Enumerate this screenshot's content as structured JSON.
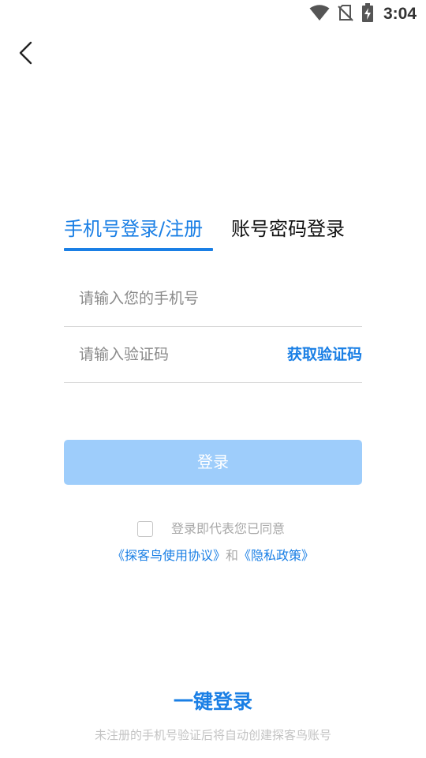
{
  "status_bar": {
    "time": "3:04",
    "icons": [
      "wifi-icon",
      "no-sim-icon",
      "battery-charging-icon"
    ]
  },
  "nav": {
    "back_icon": "chevron-left-icon"
  },
  "tabs": [
    {
      "label": "手机号登录/注册",
      "active": true
    },
    {
      "label": "账号密码登录",
      "active": false
    }
  ],
  "phone_field": {
    "placeholder": "请输入您的手机号",
    "value": ""
  },
  "code_field": {
    "placeholder": "请输入验证码",
    "value": "",
    "action_label": "获取验证码"
  },
  "login_button": {
    "label": "登录"
  },
  "agreement": {
    "checked": false,
    "text": "登录即代表您已同意",
    "user_agreement": "《探客鸟使用协议》",
    "conjunction": "和",
    "privacy_policy": "《隐私政策》"
  },
  "one_key_login": {
    "label": "一键登录"
  },
  "footer": {
    "note": "未注册的手机号验证后将自动创建探客鸟账号"
  },
  "colors": {
    "accent": "#1a7fe5",
    "button_disabled": "#9ecdfb",
    "muted_text": "#a8a8a8",
    "divider": "#d9d9d9"
  }
}
